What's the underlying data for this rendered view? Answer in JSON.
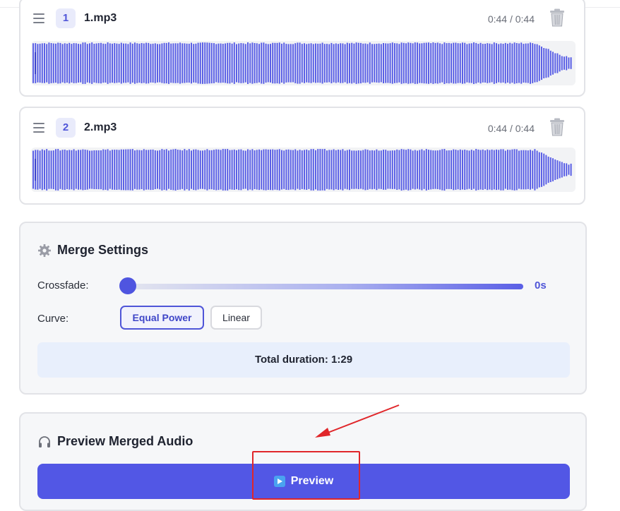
{
  "tracks": [
    {
      "index": "1",
      "filename": "1.mp3",
      "time": "0:44 / 0:44"
    },
    {
      "index": "2",
      "filename": "2.mp3",
      "time": "0:44 / 0:44"
    }
  ],
  "merge_settings": {
    "title": "Merge Settings",
    "crossfade_label": "Crossfade:",
    "crossfade_value": "0s",
    "crossfade_fraction": 0,
    "curve_label": "Curve:",
    "curve_options": [
      "Equal Power",
      "Linear"
    ],
    "curve_selected": "Equal Power",
    "total_duration": "Total duration: 1:29"
  },
  "preview": {
    "title": "Preview Merged Audio",
    "button_label": "Preview"
  },
  "colors": {
    "accent": "#5257e5",
    "waveform": "#5a5fe6",
    "annotation": "#e0262a"
  },
  "icons": {
    "drag_handle": "hamburger-icon",
    "delete": "trash-icon",
    "settings": "gear-icon",
    "headphones": "headphones-icon",
    "play": "play-icon"
  }
}
